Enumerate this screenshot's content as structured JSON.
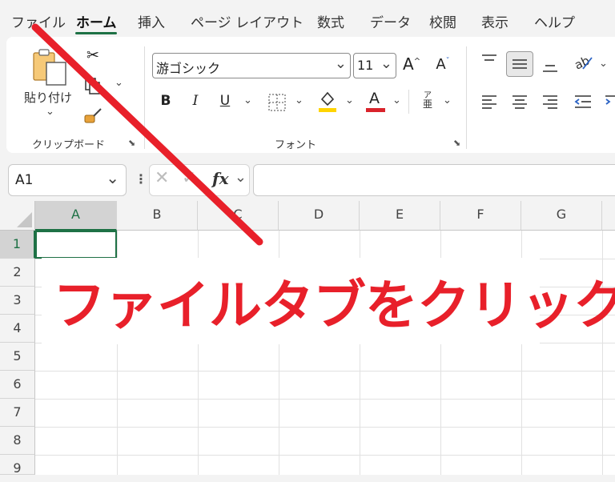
{
  "menu_tabs": {
    "file": "ファイル",
    "home": "ホーム",
    "insert": "挿入",
    "page_layout": "ページ レイアウト",
    "formulas": "数式",
    "data": "データ",
    "review": "校閲",
    "view": "表示",
    "help": "ヘルプ"
  },
  "ribbon": {
    "clipboard": {
      "paste_label": "貼り付け",
      "group_label": "クリップボード"
    },
    "font": {
      "font_name": "游ゴシック",
      "font_size": "11",
      "bold": "B",
      "italic": "I",
      "underline": "U",
      "font_color_letter": "A",
      "furigana_top": "ア",
      "furigana_bottom": "亜",
      "grow": "A",
      "shrink": "A",
      "group_label": "フォント"
    }
  },
  "formula_bar": {
    "name_box": "A1",
    "fx": "fx"
  },
  "sheet": {
    "columns": [
      "A",
      "B",
      "C",
      "D",
      "E",
      "F",
      "G"
    ],
    "rows": [
      "1",
      "2",
      "3",
      "4",
      "5",
      "6",
      "7",
      "8",
      "9"
    ],
    "active_cell": "A1"
  },
  "annotation": {
    "text": "ファイルタブをクリック"
  },
  "colors": {
    "accent_green": "#1e7145",
    "annotation_red": "#e8202a",
    "highlight_yellow": "#ffd400",
    "font_red": "#d9232b"
  }
}
